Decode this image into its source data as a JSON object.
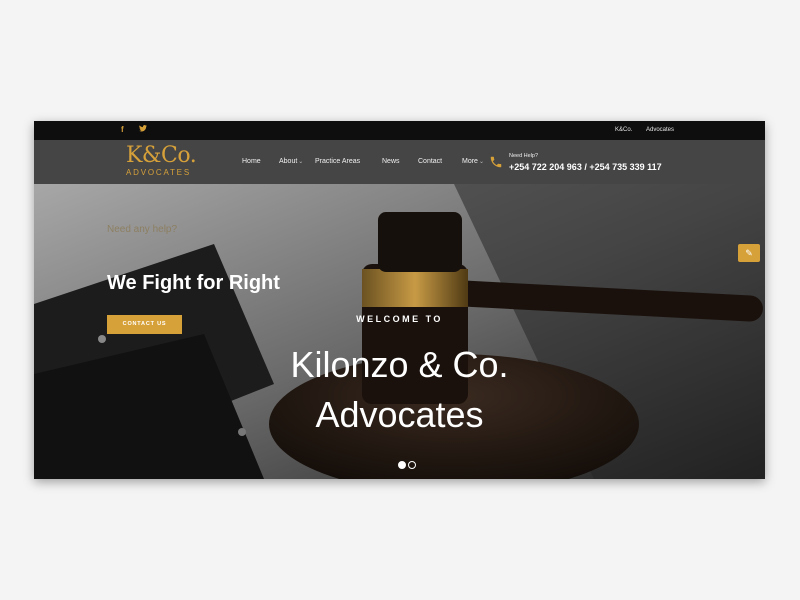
{
  "topbar": {
    "social": [
      {
        "icon": "facebook-icon",
        "glyph": "f"
      },
      {
        "icon": "twitter-icon",
        "glyph": "🐦"
      }
    ],
    "links": [
      "K&Co.",
      "Advocates"
    ]
  },
  "logo": {
    "mark": "K&Co.",
    "sub": "ADVOCATES"
  },
  "nav": {
    "items": [
      "Home",
      "About",
      "Practice Areas",
      "News",
      "Contact",
      "More"
    ]
  },
  "help": {
    "label": "Need Help?",
    "numbers": "+254 722 204 963 / +254 735 339 117"
  },
  "hero": {
    "tagline": "Need any help?",
    "headline": "We Fight for Right",
    "button": "CONTACT US",
    "welcome": "WELCOME TO",
    "title_line1": "Kilonzo & Co.",
    "title_line2": "Advocates"
  },
  "colors": {
    "accent": "#d7a13a",
    "topbar": "#0e0e0e",
    "navbar": "#484848"
  }
}
